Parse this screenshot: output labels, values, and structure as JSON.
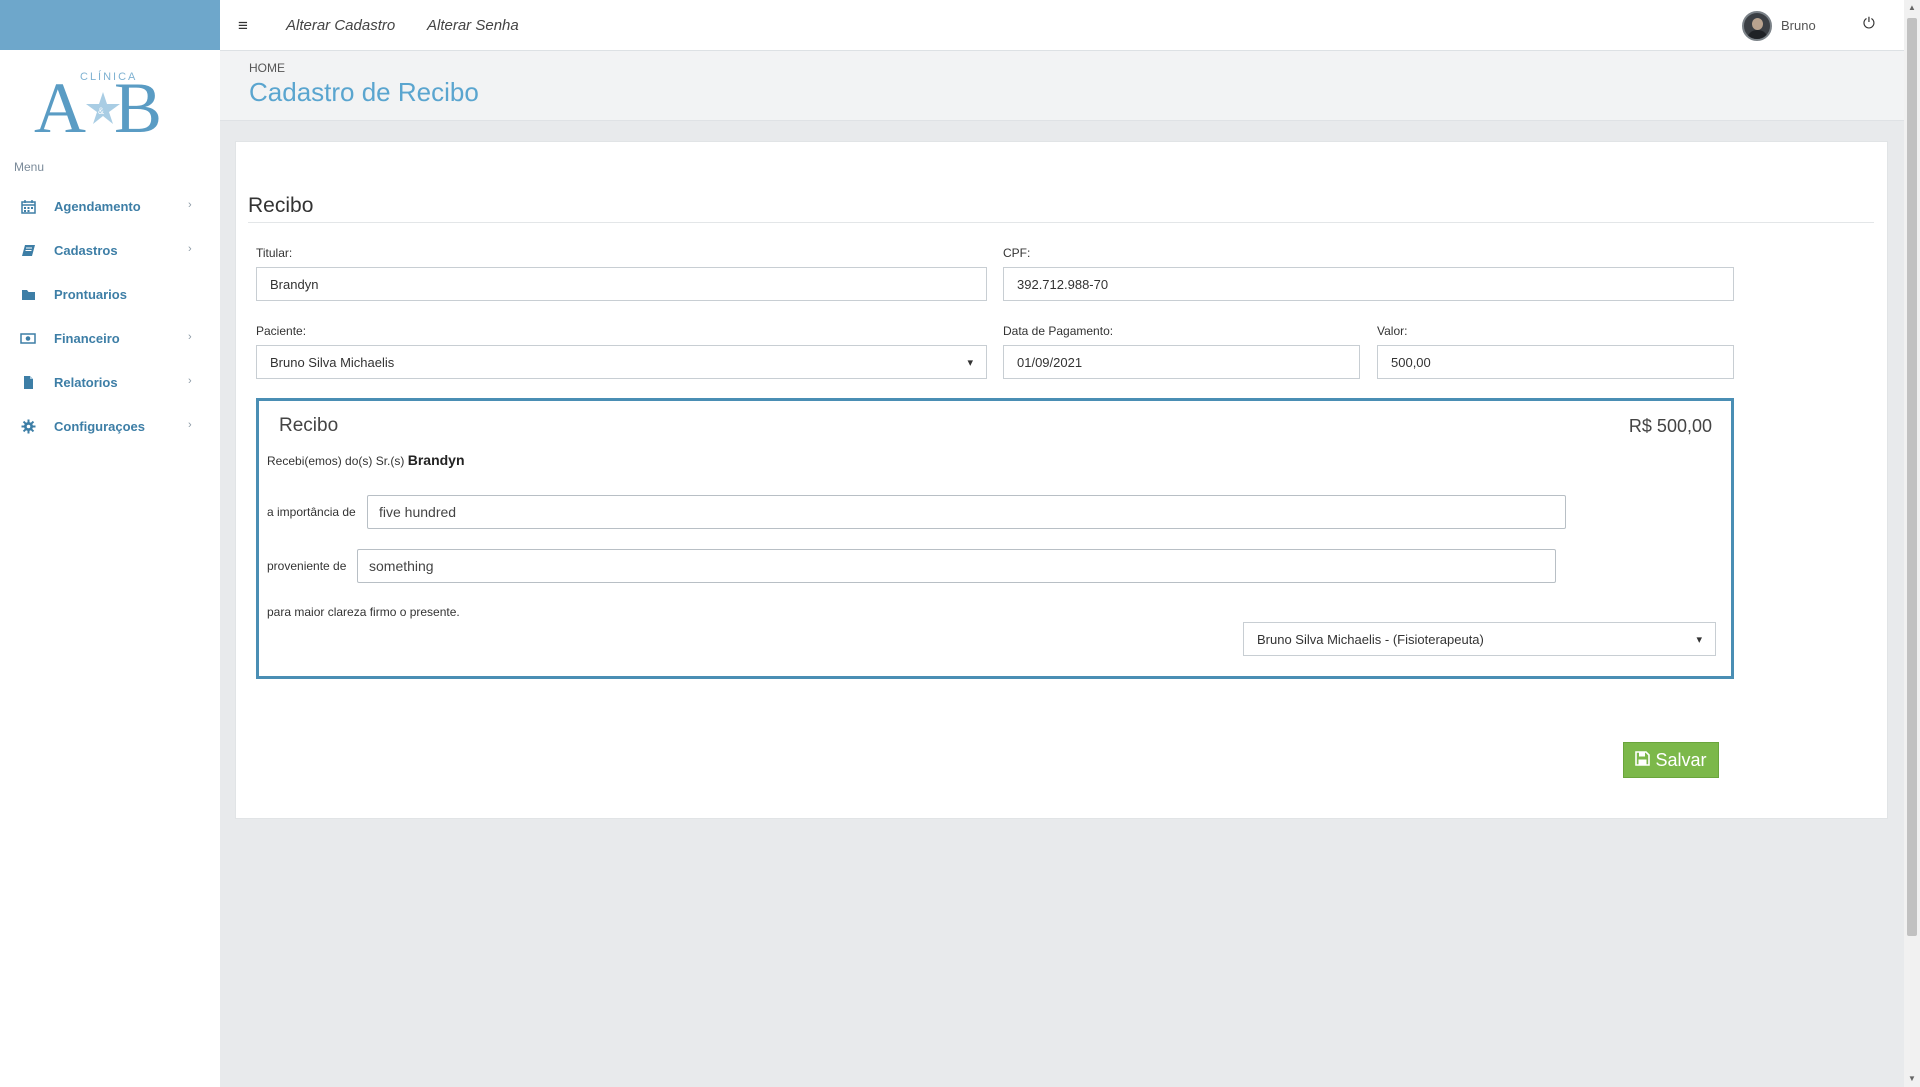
{
  "sidebar": {
    "logo_text": "CLÍNICA A&B",
    "menu_title": "Menu",
    "items": [
      {
        "label": "Agendamento",
        "icon": "calendar-icon"
      },
      {
        "label": "Cadastros",
        "icon": "book-icon"
      },
      {
        "label": "Prontuarios",
        "icon": "folder-icon"
      },
      {
        "label": "Financeiro",
        "icon": "money-icon"
      },
      {
        "label": "Relatorios",
        "icon": "file-icon"
      },
      {
        "label": "Configuraçoes",
        "icon": "gear-icon"
      }
    ]
  },
  "topbar": {
    "links": [
      "Alterar Cadastro",
      "Alterar Senha"
    ],
    "user_name": "Bruno"
  },
  "header": {
    "breadcrumb": "HOME",
    "title": "Cadastro de Recibo"
  },
  "form": {
    "section_title": "Recibo",
    "titular_label": "Titular:",
    "titular_value": "Brandyn",
    "cpf_label": "CPF:",
    "cpf_value": "392.712.988-70",
    "paciente_label": "Paciente:",
    "paciente_value": "Bruno Silva Michaelis",
    "data_label": "Data de Pagamento:",
    "data_value": "01/09/2021",
    "valor_label": "Valor:",
    "valor_value": "500,00"
  },
  "receipt": {
    "title": "Recibo",
    "amount": "R$ 500,00",
    "received_prefix": "Recebi(emos) do(s) Sr.(s)",
    "received_name": "Brandyn",
    "importancia_label": "a importância de",
    "importancia_value": "five hundred",
    "proveniente_label": "proveniente de",
    "proveniente_value": "something",
    "closing_text": "para maior clareza firmo o presente.",
    "professional_value": "Bruno Silva Michaelis - (Fisioterapeuta)"
  },
  "actions": {
    "save_label": "Salvar"
  },
  "colors": {
    "accent": "#5aa5cf",
    "sidebar_top": "#6ea7cb",
    "menu_text": "#3d7ea6",
    "save_button": "#7cb84a",
    "receipt_border": "#4a8eb4"
  }
}
